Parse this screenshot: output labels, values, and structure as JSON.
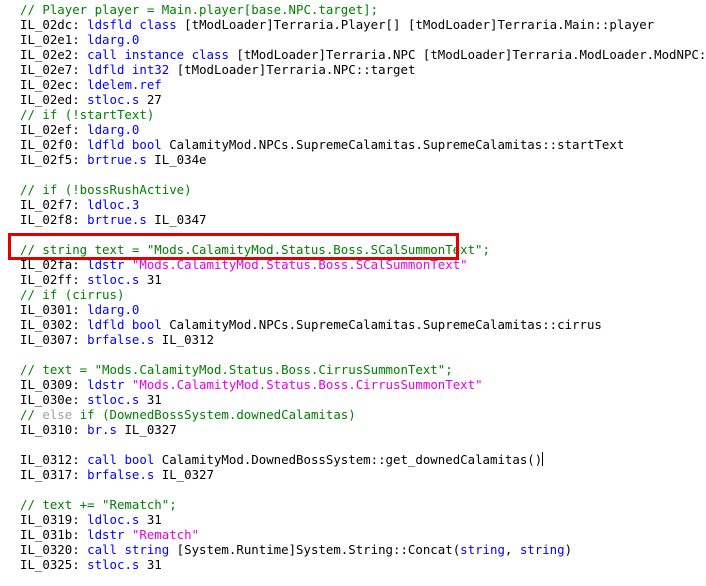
{
  "editor": {
    "lines": [
      [
        [
          "c",
          "// Player player = Main.player[base.NPC.target];"
        ]
      ],
      [
        [
          "l",
          "IL_02dc: "
        ],
        [
          "o",
          "ldsfld"
        ],
        [
          "p",
          " "
        ],
        [
          "k",
          "class"
        ],
        [
          "p",
          " [tModLoader]Terraria.Player[] [tModLoader]Terraria.Main::player"
        ]
      ],
      [
        [
          "l",
          "IL_02e1: "
        ],
        [
          "o",
          "ldarg.0"
        ]
      ],
      [
        [
          "l",
          "IL_02e2: "
        ],
        [
          "o",
          "call"
        ],
        [
          "p",
          " "
        ],
        [
          "k",
          "instance"
        ],
        [
          "p",
          " "
        ],
        [
          "k",
          "class"
        ],
        [
          "p",
          " [tModLoader]Terraria.NPC [tModLoader]Terraria.ModLoader.ModNPC::get_NPC()"
        ]
      ],
      [
        [
          "l",
          "IL_02e7: "
        ],
        [
          "o",
          "ldfld"
        ],
        [
          "p",
          " "
        ],
        [
          "k",
          "int32"
        ],
        [
          "p",
          " [tModLoader]Terraria.NPC::target"
        ]
      ],
      [
        [
          "l",
          "IL_02ec: "
        ],
        [
          "o",
          "ldelem.ref"
        ]
      ],
      [
        [
          "l",
          "IL_02ed: "
        ],
        [
          "o",
          "stloc.s"
        ],
        [
          "p",
          " 27"
        ]
      ],
      [
        [
          "c",
          "// if (!startText)"
        ]
      ],
      [
        [
          "l",
          "IL_02ef: "
        ],
        [
          "o",
          "ldarg.0"
        ]
      ],
      [
        [
          "l",
          "IL_02f0: "
        ],
        [
          "o",
          "ldfld"
        ],
        [
          "p",
          " "
        ],
        [
          "k",
          "bool"
        ],
        [
          "p",
          " CalamityMod.NPCs.SupremeCalamitas.SupremeCalamitas::startText"
        ]
      ],
      [
        [
          "l",
          "IL_02f5: "
        ],
        [
          "o",
          "brtrue.s"
        ],
        [
          "p",
          " IL_034e"
        ]
      ],
      [],
      [
        [
          "c",
          "// if (!bossRushActive)"
        ]
      ],
      [
        [
          "l",
          "IL_02f7: "
        ],
        [
          "o",
          "ldloc.3"
        ]
      ],
      [
        [
          "l",
          "IL_02f8: "
        ],
        [
          "o",
          "brtrue.s"
        ],
        [
          "p",
          " IL_0347"
        ]
      ],
      [],
      [
        [
          "c",
          "// string text = \"Mods.CalamityMod.Status.Boss.SCalSummonText\";"
        ]
      ],
      [
        [
          "l",
          "IL_02fa: "
        ],
        [
          "o",
          "ldstr"
        ],
        [
          "p",
          " "
        ],
        [
          "s",
          "\"Mods.CalamityMod.Status.Boss.SCalSummonText\""
        ]
      ],
      [
        [
          "l",
          "IL_02ff: "
        ],
        [
          "o",
          "stloc.s"
        ],
        [
          "p",
          " 31"
        ]
      ],
      [
        [
          "c",
          "// if (cirrus)"
        ]
      ],
      [
        [
          "l",
          "IL_0301: "
        ],
        [
          "o",
          "ldarg.0"
        ]
      ],
      [
        [
          "l",
          "IL_0302: "
        ],
        [
          "o",
          "ldfld"
        ],
        [
          "p",
          " "
        ],
        [
          "k",
          "bool"
        ],
        [
          "p",
          " CalamityMod.NPCs.SupremeCalamitas.SupremeCalamitas::cirrus"
        ]
      ],
      [
        [
          "l",
          "IL_0307: "
        ],
        [
          "o",
          "brfalse.s"
        ],
        [
          "p",
          " IL_0312"
        ]
      ],
      [],
      [
        [
          "c",
          "// text = \"Mods.CalamityMod.Status.Boss.CirrusSummonText\";"
        ]
      ],
      [
        [
          "l",
          "IL_0309: "
        ],
        [
          "o",
          "ldstr"
        ],
        [
          "p",
          " "
        ],
        [
          "s",
          "\"Mods.CalamityMod.Status.Boss.CirrusSummonText\""
        ]
      ],
      [
        [
          "l",
          "IL_030e: "
        ],
        [
          "o",
          "stloc.s"
        ],
        [
          "p",
          " 31"
        ]
      ],
      [
        [
          "c",
          "// "
        ],
        [
          "g",
          "else"
        ],
        [
          "c",
          " if (DownedBossSystem.downedCalamitas)"
        ]
      ],
      [
        [
          "l",
          "IL_0310: "
        ],
        [
          "o",
          "br.s"
        ],
        [
          "p",
          " IL_0327"
        ]
      ],
      [],
      [
        [
          "l",
          "IL_0312: "
        ],
        [
          "o",
          "call"
        ],
        [
          "p",
          " "
        ],
        [
          "k",
          "bool"
        ],
        [
          "p",
          " CalamityMod.DownedBossSystem::get_downedCalamitas()"
        ],
        [
          "caret",
          ""
        ]
      ],
      [
        [
          "l",
          "IL_0317: "
        ],
        [
          "o",
          "brfalse.s"
        ],
        [
          "p",
          " IL_0327"
        ]
      ],
      [],
      [
        [
          "c",
          "// text += \"Rematch\";"
        ]
      ],
      [
        [
          "l",
          "IL_0319: "
        ],
        [
          "o",
          "ldloc.s"
        ],
        [
          "p",
          " 31"
        ]
      ],
      [
        [
          "l",
          "IL_031b: "
        ],
        [
          "o",
          "ldstr"
        ],
        [
          "p",
          " "
        ],
        [
          "s",
          "\"Rematch\""
        ]
      ],
      [
        [
          "l",
          "IL_0320: "
        ],
        [
          "o",
          "call"
        ],
        [
          "p",
          " "
        ],
        [
          "k",
          "string"
        ],
        [
          "p",
          " [System.Runtime]System.String::Concat("
        ],
        [
          "k",
          "string"
        ],
        [
          "p",
          ", "
        ],
        [
          "k",
          "string"
        ],
        [
          "p",
          ")"
        ]
      ],
      [
        [
          "l",
          "IL_0325: "
        ],
        [
          "o",
          "stloc.s"
        ],
        [
          "p",
          " 31"
        ]
      ]
    ],
    "highlight_color": "#e00000",
    "colors": {
      "comment": "#008000",
      "keyword": "#0000ff",
      "string": "#e800e8",
      "gray_keyword": "#a0a0a0"
    }
  }
}
